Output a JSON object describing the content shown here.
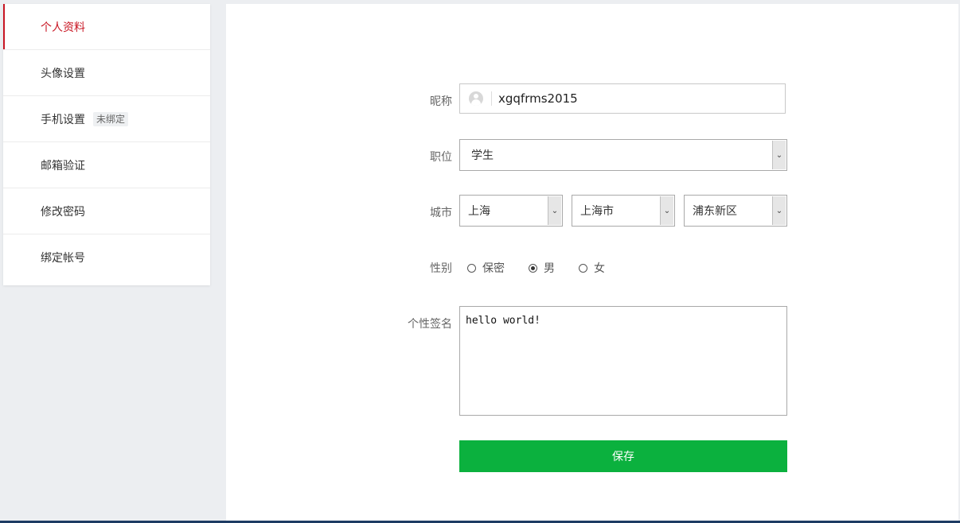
{
  "sidebar": {
    "items": [
      {
        "label": "个人资料",
        "active": true
      },
      {
        "label": "头像设置"
      },
      {
        "label": "手机设置",
        "badge": "未绑定"
      },
      {
        "label": "邮箱验证"
      },
      {
        "label": "修改密码"
      },
      {
        "label": "绑定帐号"
      }
    ]
  },
  "form": {
    "nickname": {
      "label": "昵称",
      "value": "xgqfrms2015"
    },
    "job": {
      "label": "职位",
      "value": "学生"
    },
    "city": {
      "label": "城市",
      "province": "上海",
      "city": "上海市",
      "district": "浦东新区"
    },
    "gender": {
      "label": "性别",
      "options": [
        "保密",
        "男",
        "女"
      ],
      "selected": "男"
    },
    "signature": {
      "label": "个性签名",
      "value": "hello world!"
    },
    "save_label": "保存"
  },
  "colors": {
    "accent": "#c81623",
    "save_button": "#0bb13e"
  }
}
